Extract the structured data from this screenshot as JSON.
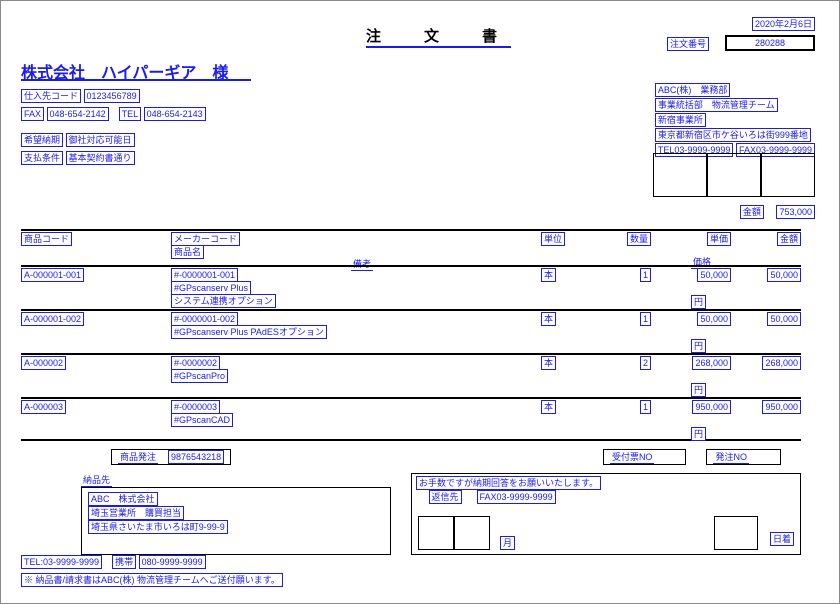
{
  "date": "2020年2月6日",
  "title": "注　文　書",
  "order_label": "注文番号",
  "order_no": "280288",
  "vendor": "株式会社　ハイパーギア　様",
  "left": {
    "shiire_label": "仕入先コード",
    "shiire": "0123456789",
    "fax_label": "FAX",
    "fax": "048-654-2142",
    "tel_label": "TEL",
    "tel": "048-654-2143",
    "kibou": "希望納期",
    "kibou_v": "御社対応可能日",
    "shiharai": "支払条件",
    "shiharai_v": "基本契約書通り"
  },
  "right": {
    "company": "ABC(株)　業務部",
    "division": "事業統括部　物流管理チーム",
    "office": "新宿事業所",
    "address": "東京都新宿区市ケ谷いろは街999番地",
    "tel": "TEL03-9999-9999",
    "fax": "FAX03-9999-9999"
  },
  "totals": {
    "label": "金額",
    "value": "753,000"
  },
  "cols": {
    "code": "商品コード",
    "maker": "メーカーコード",
    "name": "商品名",
    "remark": "備考",
    "unit": "単位",
    "qty": "数量",
    "price": "単価",
    "amount": "金額",
    "unitprice": "価格"
  },
  "rows": [
    {
      "code": "A-000001-001",
      "maker": "#-0000001-001",
      "name": "#GPscanserv Plus",
      "name2": "システム連携オプション",
      "unit": "本",
      "qty": "1",
      "price": "50,000",
      "amount": "50,000",
      "up": "円"
    },
    {
      "code": "A-000001-002",
      "maker": "#-0000001-002",
      "name": "#GPscanserv Plus PAdESオプション",
      "unit": "本",
      "qty": "1",
      "price": "50,000",
      "amount": "50,000",
      "up": "円"
    },
    {
      "code": "A-000002",
      "maker": "#-0000002",
      "name": "#GPscanPro",
      "unit": "本",
      "qty": "2",
      "price": "268,000",
      "amount": "268,000",
      "up": "円"
    },
    {
      "code": "A-000003",
      "maker": "#-0000003",
      "name": "#GPscanCAD",
      "unit": "本",
      "qty": "1",
      "price": "950,000",
      "amount": "950,000",
      "up": "円"
    }
  ],
  "ref": {
    "shohin_label": "商品発注",
    "shohin": "9876543218",
    "uketuke": "受付票NO",
    "hacchu": "発注NO"
  },
  "delivery": {
    "label": "納品先",
    "company": "ABC　株式会社",
    "dept": "埼玉営業所　購買担当",
    "address": "埼玉県さいたま市いろは町9-99-9",
    "tel": "TEL:03-9999-9999",
    "mobile_label": "携帯",
    "mobile": "080-9999-9999",
    "note": "※ 納品書/請求書はABC(株) 物流管理チームへご送付願います。"
  },
  "reply": {
    "msg": "お手数ですが納期回答をお願いいたします。",
    "reply_to": "返信先",
    "fax": "FAX03-9999-9999",
    "month": "月",
    "day": "日着"
  }
}
